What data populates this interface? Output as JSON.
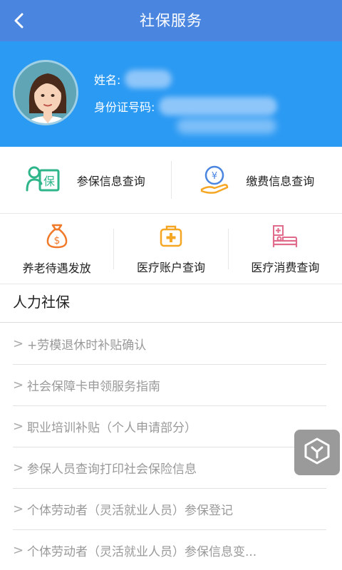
{
  "header": {
    "title": "社保服务",
    "back_icon": "back-arrow-icon"
  },
  "profile": {
    "name_label": "姓名:",
    "id_label": "身份证号码:"
  },
  "primary_services": [
    {
      "label": "参保信息查询",
      "icon": "insurance-card-icon",
      "color": "#2fb58a"
    },
    {
      "label": "缴费信息查询",
      "icon": "yen-hand-icon",
      "color": "#4a86e0"
    }
  ],
  "secondary_services": [
    {
      "label": "养老待遇发放",
      "icon": "money-bag-icon",
      "color": "#f07a2a"
    },
    {
      "label": "医疗账户查询",
      "icon": "medical-kit-icon",
      "color": "#f5a623"
    },
    {
      "label": "医疗消费查询",
      "icon": "hospital-bed-icon",
      "color": "#e06b8a"
    }
  ],
  "section": {
    "title": "人力社保"
  },
  "list_items": [
    "+劳模退休时补贴确认",
    "社会保障卡申领服务指南",
    "职业培训补贴（个人申请部分）",
    "参保人员查询打印社会保险信息",
    "个体劳动者（灵活就业人员）参保登记",
    "个体劳动者（灵活就业人员）参保信息变..."
  ],
  "list_chevron": ">",
  "floating_button": {
    "icon": "cube-icon"
  },
  "colors": {
    "nav": "#4a86e0",
    "profile_bg": "#2b9af3"
  }
}
